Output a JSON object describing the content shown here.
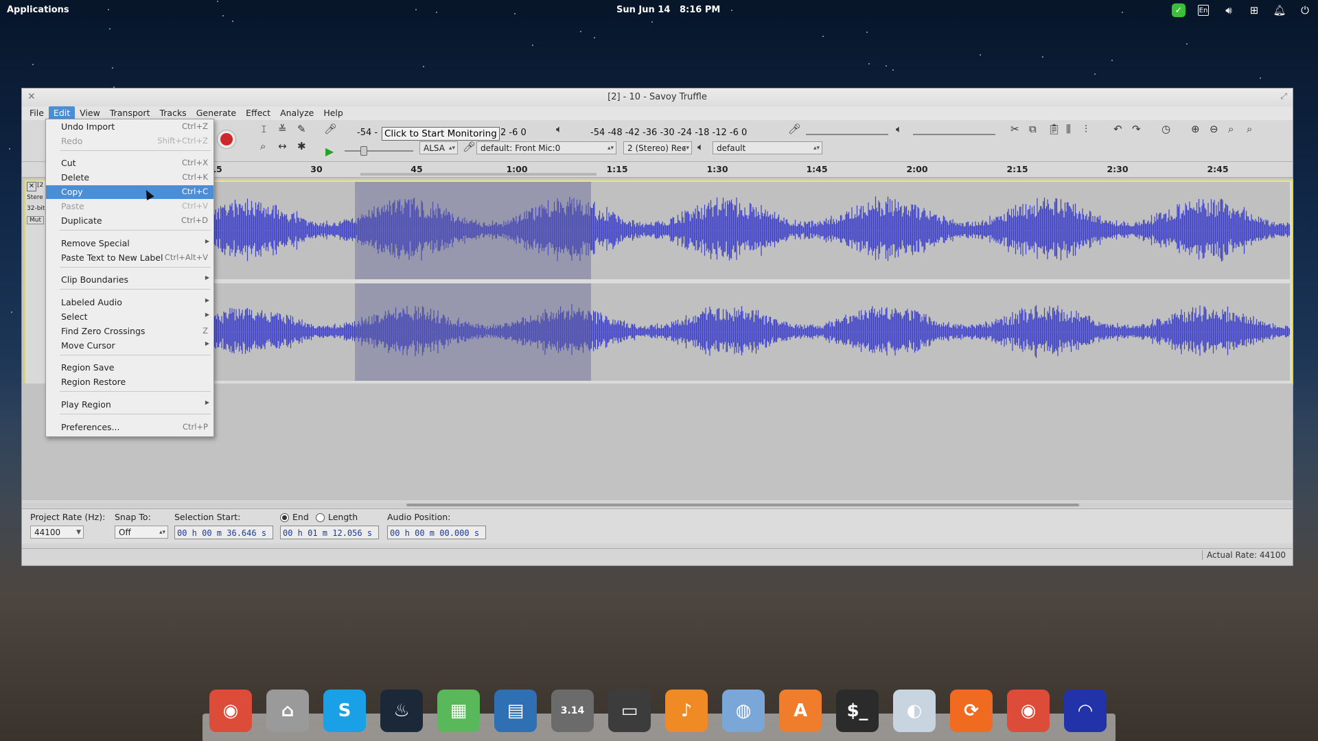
{
  "topbar": {
    "apps": "Applications",
    "date": "Sun Jun 14",
    "time": "8:16 PM",
    "lang": "En"
  },
  "window": {
    "title": "[2] - 10 - Savoy Truffle"
  },
  "menubar": [
    "File",
    "Edit",
    "View",
    "Transport",
    "Tracks",
    "Generate",
    "Effect",
    "Analyze",
    "Help"
  ],
  "toolbar": {
    "rec_meter_scale": "-54  -",
    "monitor": "Click to Start Monitoring",
    "rec_meter_scale2": "2   -6    0",
    "play_meter_scale": "-54  -48  -42  -36  -30  -24  -18  -12   -6   0",
    "host": "ALSA",
    "input_device": "default: Front Mic:0",
    "channels": "2 (Stereo) Rec",
    "output_device": "default"
  },
  "ruler": [
    "15",
    "30",
    "45",
    "1:00",
    "1:15",
    "1:30",
    "1:45",
    "2:00",
    "2:15",
    "2:30",
    "2:45"
  ],
  "track_info": {
    "line1": "[2",
    "line2": "Stere",
    "line3": "32-bit",
    "mute": "Mut"
  },
  "edit_menu": [
    {
      "label": "Undo Import",
      "shortcut": "Ctrl+Z"
    },
    {
      "label": "Redo",
      "shortcut": "Shift+Ctrl+Z"
    },
    {
      "label": "Cut",
      "shortcut": "Ctrl+X"
    },
    {
      "label": "Delete",
      "shortcut": "Ctrl+K"
    },
    {
      "label": "Copy",
      "shortcut": "Ctrl+C"
    },
    {
      "label": "Paste",
      "shortcut": "Ctrl+V"
    },
    {
      "label": "Duplicate",
      "shortcut": "Ctrl+D"
    },
    {
      "label": "Remove Special",
      "shortcut": ""
    },
    {
      "label": "Paste Text to New Label",
      "shortcut": "Ctrl+Alt+V"
    },
    {
      "label": "Clip Boundaries",
      "shortcut": ""
    },
    {
      "label": "Labeled Audio",
      "shortcut": ""
    },
    {
      "label": "Select",
      "shortcut": ""
    },
    {
      "label": "Find Zero Crossings",
      "shortcut": "Z"
    },
    {
      "label": "Move Cursor",
      "shortcut": ""
    },
    {
      "label": "Region Save",
      "shortcut": ""
    },
    {
      "label": "Region Restore",
      "shortcut": ""
    },
    {
      "label": "Play Region",
      "shortcut": ""
    },
    {
      "label": "Preferences...",
      "shortcut": "Ctrl+P"
    }
  ],
  "selection_bar": {
    "project_rate_label": "Project Rate (Hz):",
    "project_rate": "44100",
    "snap_label": "Snap To:",
    "snap": "Off",
    "sel_start_label": "Selection Start:",
    "sel_start": "00 h 00 m 36.646 s",
    "end_label": "End",
    "length_label": "Length",
    "end": "00 h 01 m 12.056 s",
    "audio_pos_label": "Audio Position:",
    "audio_pos": "00 h 00 m 00.000 s"
  },
  "status": {
    "actual_rate": "Actual Rate: 44100"
  },
  "dock": [
    {
      "name": "chrome",
      "glyph": "◉",
      "color": "#dd4b39"
    },
    {
      "name": "files",
      "glyph": "⌂",
      "color": "#9a9a9a"
    },
    {
      "name": "skype",
      "glyph": "S",
      "color": "#1aa0e6"
    },
    {
      "name": "steam",
      "glyph": "♨",
      "color": "#1b2838"
    },
    {
      "name": "calendar",
      "glyph": "▦",
      "color": "#58b85a"
    },
    {
      "name": "document-viewer",
      "glyph": "▤",
      "color": "#2f6fb3"
    },
    {
      "name": "calculator",
      "glyph": "3.14",
      "color": "#6b6b6b"
    },
    {
      "name": "screenshot",
      "glyph": "▭",
      "color": "#3c3c3c"
    },
    {
      "name": "music",
      "glyph": "♪",
      "color": "#f08a24"
    },
    {
      "name": "photos",
      "glyph": "◍",
      "color": "#7aa6d8"
    },
    {
      "name": "app-center",
      "glyph": "A",
      "color": "#f07d2b"
    },
    {
      "name": "terminal",
      "glyph": "$_",
      "color": "#2b2b2b"
    },
    {
      "name": "switchboard",
      "glyph": "◐",
      "color": "#c8d4e0"
    },
    {
      "name": "updater",
      "glyph": "⟳",
      "color": "#f06a1f"
    },
    {
      "name": "chrome-2",
      "glyph": "◉",
      "color": "#dd4b39"
    },
    {
      "name": "audacity",
      "glyph": "◠",
      "color": "#2233aa"
    }
  ]
}
